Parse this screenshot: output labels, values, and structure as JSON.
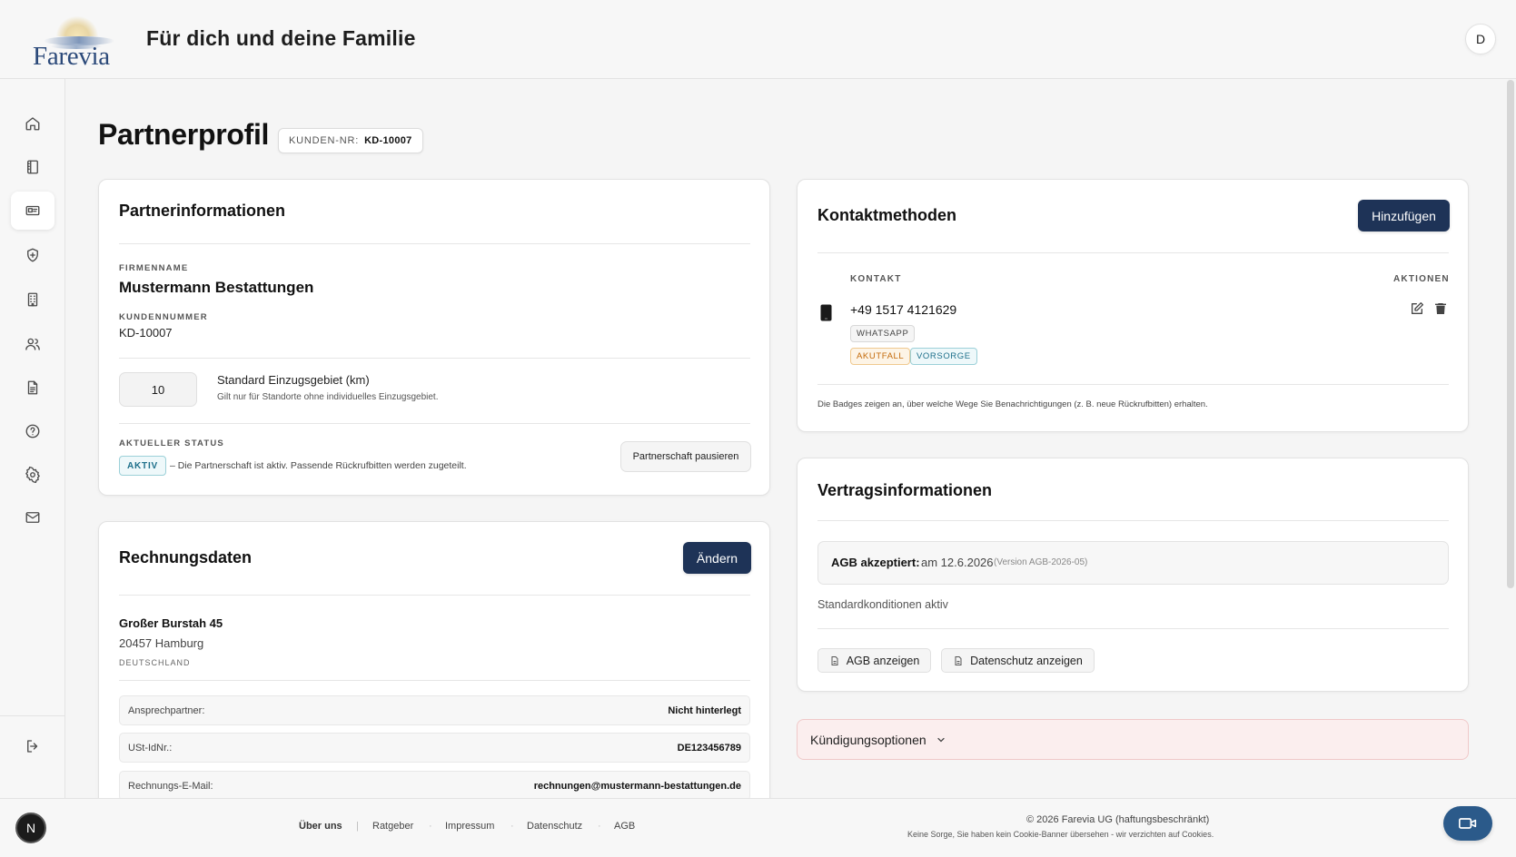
{
  "header": {
    "logo_text": "Farevia",
    "title": "Für dich und deine Familie",
    "avatar_initial": "D"
  },
  "sidebar": {
    "items": [
      {
        "icon": "home-icon"
      },
      {
        "icon": "book-icon"
      },
      {
        "icon": "id-card-icon",
        "active": true
      },
      {
        "icon": "shield-plus-icon"
      },
      {
        "icon": "building-icon"
      },
      {
        "icon": "users-icon"
      },
      {
        "icon": "document-icon"
      },
      {
        "icon": "help-circle-icon"
      },
      {
        "icon": "gear-icon"
      },
      {
        "icon": "mail-icon"
      }
    ],
    "logout_icon": "logout-icon"
  },
  "page": {
    "title": "Partnerprofil",
    "customer_badge_label": "KUNDEN-NR:",
    "customer_badge_value": "KD-10007"
  },
  "partner_info": {
    "title": "Partnerinformationen",
    "company_label": "FIRMENNAME",
    "company_value": "Mustermann Bestattungen",
    "customer_number_label": "KUNDENNUMMER",
    "customer_number_value": "KD-10007",
    "radius_value": "10",
    "radius_title": "Standard Einzugsgebiet (km)",
    "radius_hint": "Gilt nur für Standorte ohne individuelles Einzugsgebiet.",
    "status_label": "AKTUELLER STATUS",
    "status_badge": "AKTIV",
    "status_text": "– Die Partnerschaft ist aktiv. Passende Rückrufbitten werden zugeteilt.",
    "pause_button": "Partnerschaft pausieren"
  },
  "billing": {
    "title": "Rechnungsdaten",
    "edit_button": "Ändern",
    "street": "Großer Burstah 45",
    "city": "20457 Hamburg",
    "country": "DEUTSCHLAND",
    "rows": [
      {
        "label": "Ansprechpartner:",
        "value": "Nicht hinterlegt"
      },
      {
        "label": "USt-IdNr.:",
        "value": "DE123456789"
      },
      {
        "label": "Rechnungs-E-Mail:",
        "value": "rechnungen@mustermann-bestattungen.de"
      }
    ]
  },
  "contacts": {
    "title": "Kontaktmethoden",
    "add_button": "Hinzufügen",
    "col_contact": "KONTAKT",
    "col_actions": "AKTIONEN",
    "phone": "+49 1517 4121629",
    "tag_channel": "WHATSAPP",
    "tag_acute": "AKUTFALL",
    "tag_provision": "VORSORGE",
    "note": "Die Badges zeigen an, über welche Wege Sie Benachrichtigungen (z. B. neue Rückrufbitten) erhalten.",
    "colors": {
      "acute": "#c46a0a",
      "provision": "#1d6f8a"
    }
  },
  "contract": {
    "title": "Vertragsinformationen",
    "agb_bold": "AGB akzeptiert:",
    "agb_date": "am 12.6.2026",
    "agb_version": "(Version AGB-2026-05)",
    "conditions": "Standardkonditionen aktiv",
    "show_agb": "AGB anzeigen",
    "show_privacy": "Datenschutz anzeigen"
  },
  "termination": {
    "label": "Kündigungsoptionen"
  },
  "footer": {
    "n_badge": "N",
    "links": [
      "Über uns",
      "Ratgeber",
      "Impressum",
      "Datenschutz",
      "AGB"
    ],
    "copyright": "© 2026 Farevia UG (haftungsbeschränkt)",
    "cookie_note": "Keine Sorge, Sie haben kein Cookie-Banner übersehen - wir verzichten auf Cookies."
  },
  "colors": {
    "primary": "#1e3357",
    "status_active": "#1d6f8a",
    "termination_bg": "#fbeeee"
  }
}
